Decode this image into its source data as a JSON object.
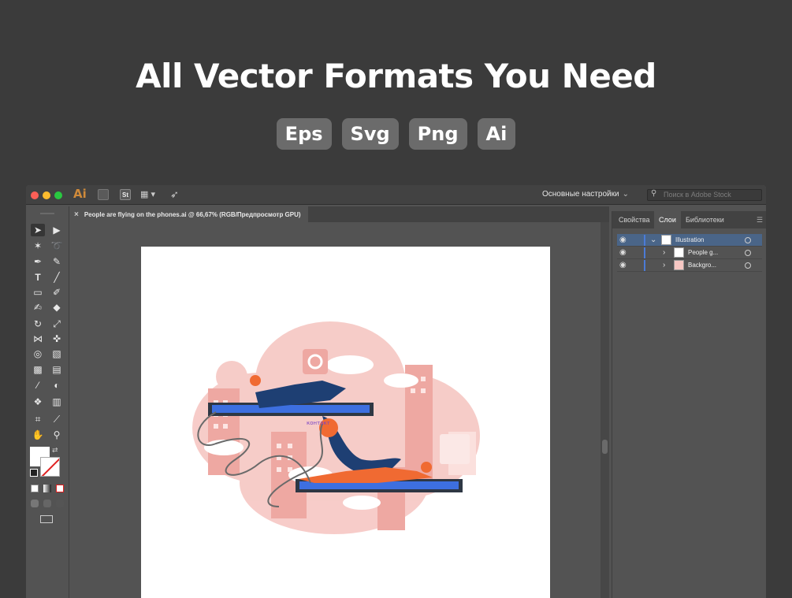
{
  "hero": {
    "title": "All Vector Formats You Need",
    "formats": [
      "Eps",
      "Svg",
      "Png",
      "Ai"
    ]
  },
  "app": {
    "logo": "Ai",
    "stock_badge": "St",
    "workspace": "Основные настройки",
    "search_placeholder": "Поиск в Adobe Stock",
    "document_tab": "People are flying on the phones.ai @ 66,67% (RGB/Предпросмотр GPU)",
    "panel_tabs": [
      "Свойства",
      "Слои",
      "Библиотеки"
    ],
    "active_panel_tab": "Слои",
    "layers": [
      {
        "name": "Illustration",
        "expanded": true
      },
      {
        "name": "People g...",
        "expanded": false
      },
      {
        "name": "Backgro...",
        "expanded": false
      }
    ],
    "icons": {
      "close": "close-icon",
      "eye": "eye-icon",
      "chevron": "chevron-down-icon",
      "search": "search-icon"
    }
  },
  "artwork": {
    "label": "контакт"
  },
  "colors": {
    "hero_bg": "#3b3b3b",
    "app_chrome": "#535353",
    "ai_orange": "#cf8a3a",
    "layer_selection": "#4a6588",
    "illustration_pink": "#f6c7c3",
    "illustration_navy": "#1e3f73",
    "illustration_orange": "#f06a32",
    "illustration_blue": "#3d6fe0"
  }
}
